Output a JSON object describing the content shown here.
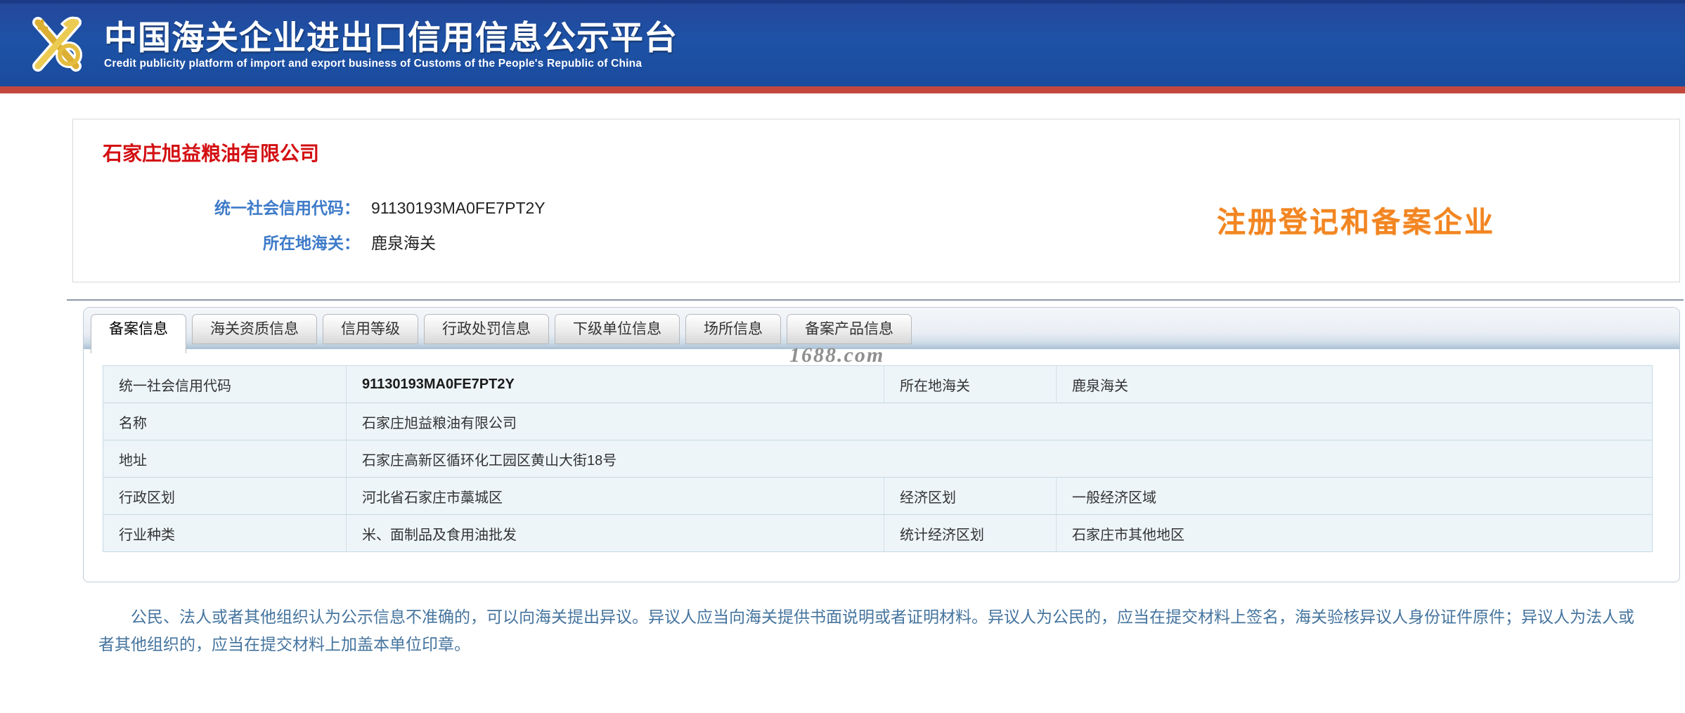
{
  "header": {
    "title": "中国海关企业进出口信用信息公示平台",
    "subtitle": "Credit publicity platform of import and export business of Customs of the People's Republic of China",
    "logo_icon": "customs-emblem-gold"
  },
  "company": {
    "name": "石家庄旭益粮油有限公司",
    "credit_code_label": "统一社会信用代码：",
    "credit_code": "91130193MA0FE7PT2Y",
    "customs_label": "所在地海关：",
    "customs": "鹿泉海关",
    "badge": "注册登记和备案企业"
  },
  "tabs": [
    {
      "label": "备案信息",
      "active": true
    },
    {
      "label": "海关资质信息",
      "active": false
    },
    {
      "label": "信用等级",
      "active": false
    },
    {
      "label": "行政处罚信息",
      "active": false
    },
    {
      "label": "下级单位信息",
      "active": false
    },
    {
      "label": "场所信息",
      "active": false
    },
    {
      "label": "备案产品信息",
      "active": false
    }
  ],
  "watermark": "1688.com",
  "record_table": {
    "rows": [
      {
        "cells": [
          {
            "label": "统一社会信用代码",
            "value": "91130193MA0FE7PT2Y"
          },
          {
            "label": "所在地海关",
            "value": "鹿泉海关"
          }
        ]
      },
      {
        "cells": [
          {
            "label": "名称",
            "value": "石家庄旭益粮油有限公司"
          }
        ]
      },
      {
        "cells": [
          {
            "label": "地址",
            "value": "石家庄高新区循环化工园区黄山大街18号"
          }
        ]
      },
      {
        "cells": [
          {
            "label": "行政区划",
            "value": "河北省石家庄市藁城区"
          },
          {
            "label": "经济区划",
            "value": "一般经济区域"
          }
        ]
      },
      {
        "cells": [
          {
            "label": "行业种类",
            "value": "米、面制品及食用油批发"
          },
          {
            "label": "统计经济区划",
            "value": "石家庄市其他地区"
          }
        ]
      }
    ]
  },
  "footer": {
    "notice": "公民、法人或者其他组织认为公示信息不准确的，可以向海关提出异议。异议人应当向海关提供书面说明或者证明材料。异议人为公民的，应当在提交材料上签名，海关验核异议人身份证件原件；异议人为法人或者其他组织的，应当在提交材料上加盖本单位印章。"
  },
  "colors": {
    "header_blue": "#1D52A6",
    "red_bar": "#C4473E",
    "company_name_red": "#D30F12",
    "label_blue": "#3D7AC8",
    "badge_orange": "#F28522",
    "footer_blue": "#45749E",
    "table_row_bg": "#EDF5F9"
  }
}
